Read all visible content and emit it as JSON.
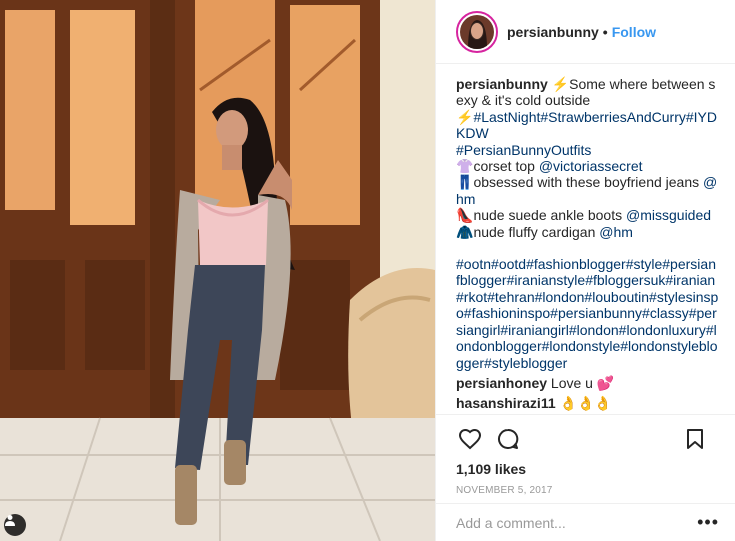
{
  "post": {
    "username": "persianbunny",
    "follow_label": "Follow",
    "dot": "•"
  },
  "caption": {
    "username": "persianbunny",
    "lines": [
      {
        "emoji": "⚡",
        "text": "Some where between sexy & it's cold outside "
      },
      {
        "emoji": "⚡",
        "tags": "#LastNight#StrawberriesAndCurry#IYDKDW"
      },
      {
        "tags": "#PersianBunnyOutfits"
      },
      {
        "emoji": "👚",
        "text": "corset top ",
        "tag": "@victoriassecret"
      },
      {
        "emoji": "👖",
        "text": "obsessed with these boyfriend jeans ",
        "tag": "@hm"
      },
      {
        "emoji": "👠",
        "text": "nude suede ankle boots ",
        "tag": "@missguided"
      },
      {
        "emoji": "🧥",
        "text": "nude fluffy cardigan ",
        "tag": "@hm"
      }
    ],
    "hashtags": "#ootn#ootd#fashionblogger#style#persianfblogger#iranianstyle#fbloggersuk#iranian#rkot#tehran#london#louboutin#stylesinspo#fashioninspo#persianbunny#classy#persiangirl#iraniangirl#london#londonluxury#londonblogger#londonstyle#londonstyleblogger#styleblogger"
  },
  "comments": [
    {
      "username": "persianhoney",
      "text": "Love u 💕"
    },
    {
      "username": "hasanshirazi11",
      "text": "👌👌👌"
    }
  ],
  "icons": {
    "like": "heart-icon",
    "comment": "comment-icon",
    "save": "bookmark-icon",
    "tagged": "person-tag-icon",
    "more": "more-icon"
  },
  "likes_text": "1,109 likes",
  "date_text": "NOVEMBER 5, 2017",
  "add_comment": {
    "placeholder": "Add a comment...",
    "more": "•••"
  },
  "colors": {
    "link": "#003569",
    "follow": "#3897f0",
    "avatar_ring": "#d6249f",
    "meta": "#999999"
  }
}
